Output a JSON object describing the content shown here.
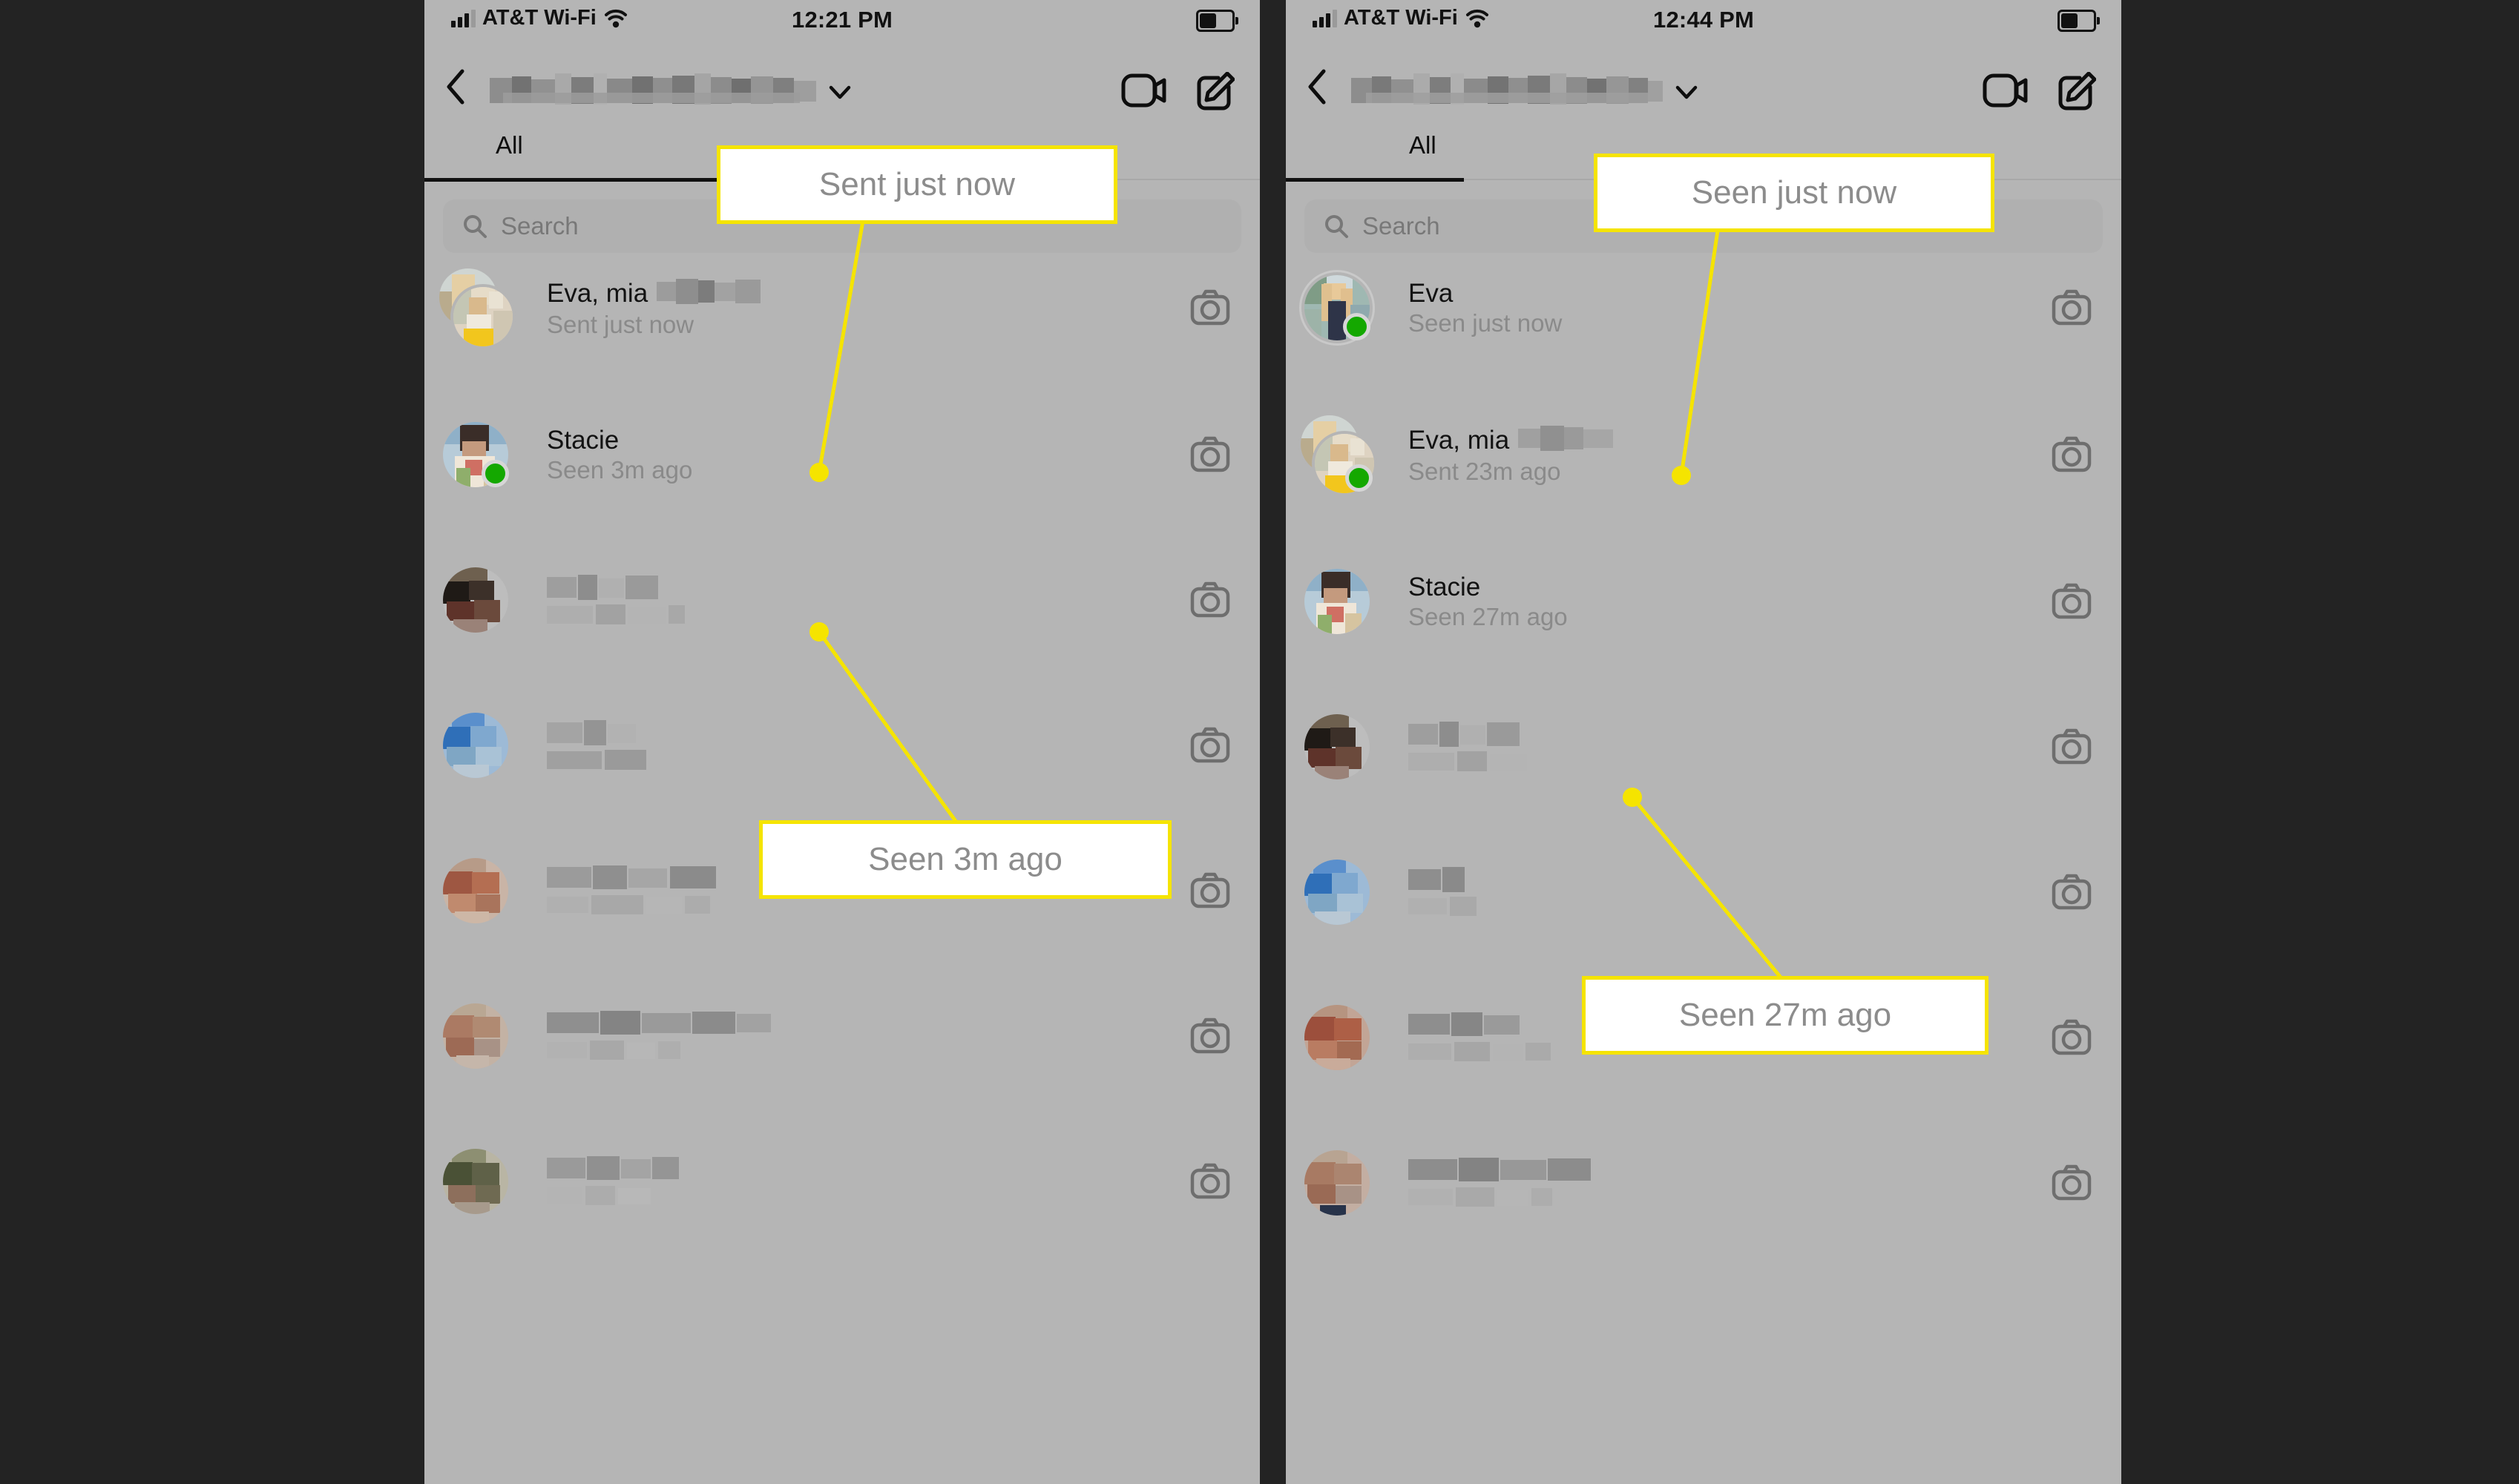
{
  "theme": {
    "page_background": "#232323",
    "phone_background": "#b5b5b5",
    "callout_border": "#f5e400",
    "callout_text": "#8c8c8c",
    "online_badge": "#14a800",
    "primary_text": "#121212",
    "secondary_text": "#8a8a8a",
    "search_fill": "#b0b0b0"
  },
  "phones": [
    {
      "id": "left",
      "status_bar": {
        "carrier": "AT&T Wi-Fi",
        "time": "12:21 PM",
        "signal_icon": "cellular-bars-icon",
        "wifi_icon": "wifi-icon",
        "battery_icon": "battery-icon"
      },
      "nav": {
        "back_icon": "chevron-left-icon",
        "title": "",
        "title_redacted": true,
        "dropdown_icon": "chevron-down-icon",
        "video_icon": "video-camera-icon",
        "compose_icon": "compose-pencil-icon"
      },
      "tabs": {
        "items": [
          {
            "label": "All",
            "active": true
          }
        ]
      },
      "search": {
        "placeholder": "Search",
        "icon": "search-icon",
        "value": ""
      },
      "conversations": [
        {
          "name": "Eva, mia",
          "name_redacted_suffix": true,
          "status": "Sent just now",
          "avatar_type": "stacked",
          "online": false,
          "camera_icon": "camera-icon"
        },
        {
          "name": "Stacie",
          "name_redacted_suffix": false,
          "status": "Seen 3m ago",
          "avatar_type": "single",
          "online": true,
          "camera_icon": "camera-icon"
        },
        {
          "name": "",
          "status": "",
          "redacted": true,
          "avatar_tone": "#5a463d",
          "camera_icon": "camera-icon"
        },
        {
          "name": "",
          "status": "",
          "redacted": true,
          "avatar_tone": "#3f7ec0",
          "camera_icon": "camera-icon"
        },
        {
          "name": "",
          "status": "",
          "redacted": true,
          "avatar_tone": "#b06a52",
          "camera_icon": "camera-icon"
        },
        {
          "name": "",
          "status": "",
          "redacted": true,
          "avatar_tone": "#a67c63",
          "camera_icon": "camera-icon"
        },
        {
          "name": "",
          "status": "",
          "redacted": true,
          "avatar_tone": "#5f6148",
          "camera_icon": "camera-icon"
        }
      ],
      "callouts": [
        {
          "text": "Sent just now",
          "target": "Sent just now status of Eva, mia row"
        },
        {
          "text": "Seen 3m ago",
          "target": "Seen 3m ago status of Stacie row"
        }
      ]
    },
    {
      "id": "right",
      "status_bar": {
        "carrier": "AT&T Wi-Fi",
        "time": "12:44 PM",
        "signal_icon": "cellular-bars-icon",
        "wifi_icon": "wifi-icon",
        "battery_icon": "battery-icon"
      },
      "nav": {
        "back_icon": "chevron-left-icon",
        "title": "",
        "title_redacted": true,
        "dropdown_icon": "chevron-down-icon",
        "video_icon": "video-camera-icon",
        "compose_icon": "compose-pencil-icon"
      },
      "tabs": {
        "items": [
          {
            "label": "All",
            "active": true
          }
        ]
      },
      "search": {
        "placeholder": "Search",
        "icon": "search-icon",
        "value": ""
      },
      "conversations": [
        {
          "name": "Eva",
          "name_redacted_suffix": false,
          "status": "Seen just now",
          "avatar_type": "single",
          "online": true,
          "camera_icon": "camera-icon"
        },
        {
          "name": "Eva, mia",
          "name_redacted_suffix": true,
          "status": "Sent 23m ago",
          "avatar_type": "stacked",
          "online": true,
          "camera_icon": "camera-icon"
        },
        {
          "name": "Stacie",
          "name_redacted_suffix": false,
          "status": "Seen 27m ago",
          "avatar_type": "single",
          "online": false,
          "camera_icon": "camera-icon"
        },
        {
          "name": "",
          "status": "",
          "redacted": true,
          "avatar_tone": "#5a463d",
          "camera_icon": "camera-icon"
        },
        {
          "name": "",
          "status": "",
          "redacted": true,
          "avatar_tone": "#3f7ec0",
          "camera_icon": "camera-icon"
        },
        {
          "name": "",
          "status": "",
          "redacted": true,
          "avatar_tone": "#a85b45",
          "camera_icon": "camera-icon"
        },
        {
          "name": "",
          "status": "",
          "redacted": true,
          "avatar_tone": "#9c6a56",
          "camera_icon": "camera-icon"
        }
      ],
      "callouts": [
        {
          "text": "Seen just now",
          "target": "Seen just now status of Eva row"
        },
        {
          "text": "Seen 27m ago",
          "target": "Seen 27m ago status of Stacie row"
        }
      ]
    }
  ],
  "callout_texts": {
    "c1": "Sent just now",
    "c2": "Seen 3m ago",
    "c3": "Seen just now",
    "c4": "Seen 27m ago"
  }
}
